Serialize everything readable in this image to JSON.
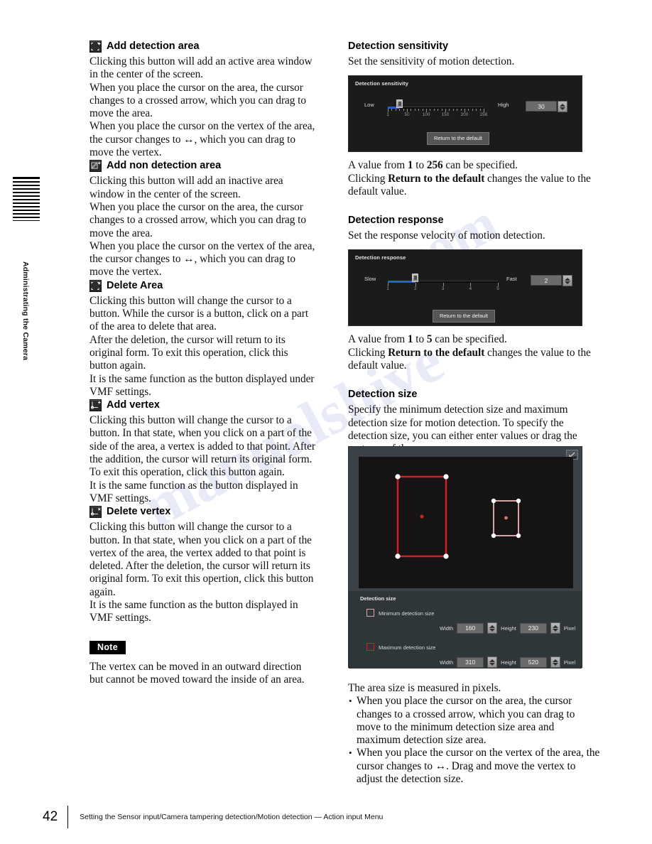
{
  "page": {
    "sidebar_label": "Administrating the Camera",
    "footer_page_number": "42",
    "footer_text": "Setting the Sensor input/Camera tampering detection/Motion detection — Action input Menu",
    "watermark_1": "manualshive",
    "watermark_2": ".com"
  },
  "left_column": {
    "sections": [
      {
        "icon": "add-detection-area-icon",
        "heading": "Add detection area",
        "paragraphs": [
          "Clicking this button will add an active area window in the center of the screen.",
          "When you place the cursor on the area, the cursor changes to a crossed arrow, which you can drag to move the area.",
          "When you place the cursor on the vertex of the area, the cursor changes to ↔, which you can drag to move the vertex."
        ]
      },
      {
        "icon": "add-non-detection-area-icon",
        "heading": "Add non detection area",
        "paragraphs": [
          "Clicking this button will add an inactive area window in the center of the screen.",
          "When you place the cursor on the area, the cursor changes to a crossed arrow, which you can drag to move the area.",
          "When you place the cursor on the vertex of the area, the cursor changes to ↔, which you can drag to move the vertex."
        ]
      },
      {
        "icon": "delete-area-icon",
        "heading": "Delete Area",
        "paragraphs": [
          "Clicking this button will change the cursor to a button. While the cursor is a button, click on a part of the area to delete that area.",
          "After the deletion, the cursor will return to its original form. To exit this operation, click this button again.",
          "It is the same function as the button displayed under VMF settings."
        ]
      },
      {
        "icon": "add-vertex-icon",
        "heading": "Add vertex",
        "paragraphs": [
          "Clicking this button will change the cursor to a button. In that state, when you click on a part of the side of the area, a vertex is added to that point. After the addition, the cursor will return its original form. To exit this operation, click this button again.",
          "It is the same function as the button displayed in VMF settings."
        ]
      },
      {
        "icon": "delete-vertex-icon",
        "heading": "Delete vertex",
        "paragraphs": [
          "Clicking this button will change the cursor to a button. In that state, when you click on a part of the vertex of the area, the vertex added to that point is deleted. After the deletion, the cursor will return its original form. To exit this opertion, click this button again.",
          "It is the same function as the button displayed in VMF settings."
        ]
      }
    ],
    "note": {
      "badge": "Note",
      "text": "The vertex can be moved in an outward direction but cannot be moved toward the inside of an area."
    }
  },
  "right_column": {
    "detection_sensitivity": {
      "heading": "Detection sensitivity",
      "intro": "Set the sensitivity of motion detection.",
      "panel": {
        "title": "Detection sensitivity",
        "low_label": "Low",
        "high_label": "High",
        "value": "30",
        "tick_labels": [
          "1",
          "50",
          "100",
          "150",
          "200",
          "256"
        ],
        "return_button": "Return to the default",
        "fill_color": "#2a5fd4"
      },
      "after_text_1_pre": "A value from ",
      "after_min": "1",
      "after_text_1_mid": " to ",
      "after_max": "256",
      "after_text_1_post": " can be specified.",
      "after_text_2_pre": "Clicking ",
      "after_bold": "Return to the default",
      "after_text_2_post": " changes the value to the default value."
    },
    "detection_response": {
      "heading": "Detection response",
      "intro": "Set the response velocity of motion detection.",
      "panel": {
        "title": "Detection response",
        "low_label": "Slow",
        "high_label": "Fast",
        "value": "2",
        "tick_labels": [
          "1",
          "2",
          "3",
          "4",
          "5"
        ],
        "return_button": "Return to the default",
        "fill_color": "#2a5fd4"
      },
      "after_text_1_pre": "A value from ",
      "after_min": "1",
      "after_text_1_mid": " to ",
      "after_max": "5",
      "after_text_1_post": " can be specified.",
      "after_text_2_pre": "Clicking ",
      "after_bold": "Return to the default",
      "after_text_2_post": " changes the value to the default value."
    },
    "detection_size": {
      "heading": "Detection size",
      "intro": "Specify the minimum detection size and maximum detection size for motion detection. To specify the detection size, you can either enter values or drag the vertexes of the area.",
      "panel": {
        "title": "Detection size",
        "minimum": {
          "label": "Minimum detection size",
          "swatch_color": "#d59a9a",
          "width_label": "Width",
          "width_value": "160",
          "height_label": "Height",
          "height_value": "230",
          "unit_label": "Pixel"
        },
        "maximum": {
          "label": "Maximum detection size",
          "swatch_color": "#cc2222",
          "width_label": "Width",
          "width_value": "310",
          "height_label": "Height",
          "height_value": "520",
          "unit_label": "Pixel"
        }
      },
      "after_text": "The area size is measured in pixels.",
      "bullets": [
        "When you place the cursor on the area, the cursor changes to a crossed arrow, which you can drag to move to the minimum detection size area and maximum detection size area.",
        "When you place the cursor on the vertex of the area, the cursor changes to ↔. Drag and move the vertex to adjust the detection size."
      ]
    }
  }
}
